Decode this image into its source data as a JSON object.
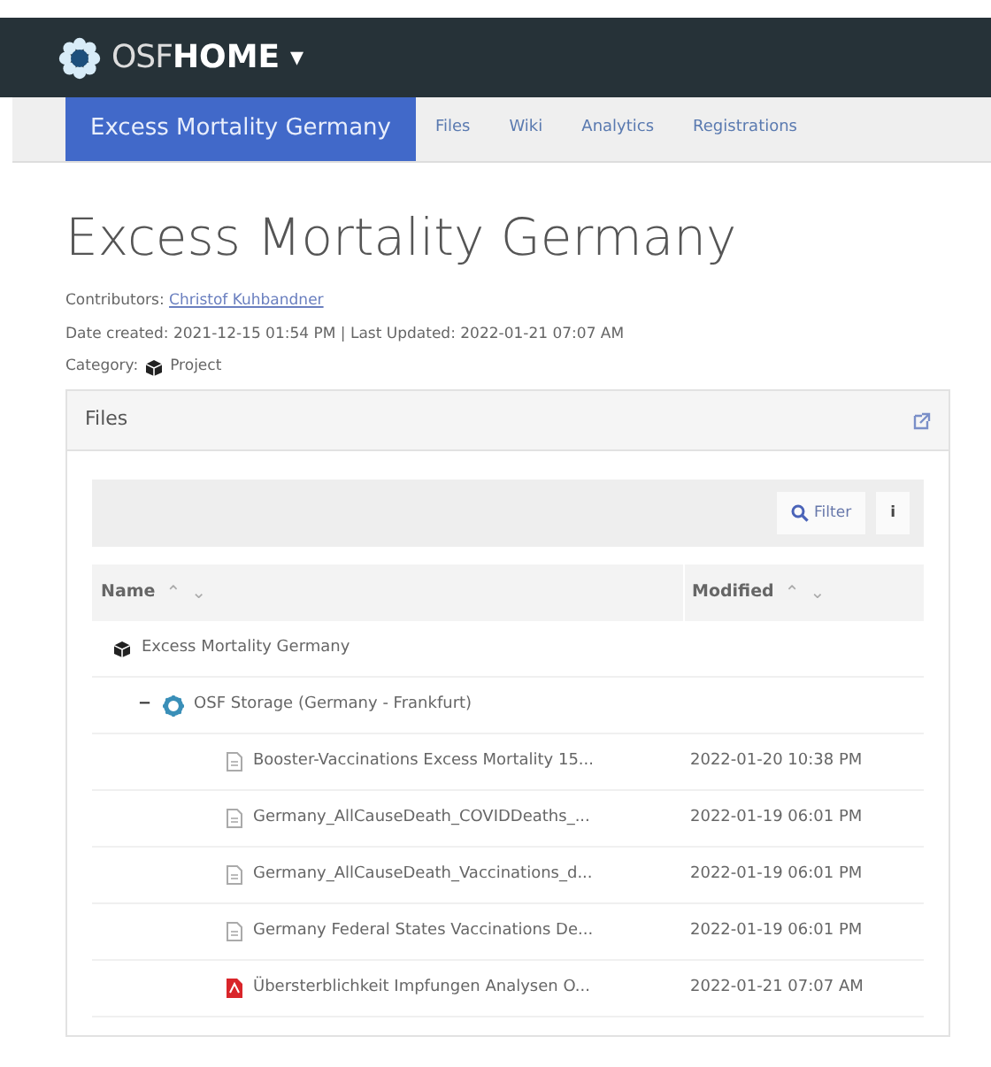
{
  "navbar": {
    "brand_light": "OSF",
    "brand_bold": "HOME",
    "caret": "▾"
  },
  "project_nav": [
    {
      "label": "Excess Mortality Germany",
      "selected": true
    },
    {
      "label": "Files",
      "selected": false
    },
    {
      "label": "Wiki",
      "selected": false
    },
    {
      "label": "Analytics",
      "selected": false
    },
    {
      "label": "Registrations",
      "selected": false
    }
  ],
  "title": "Excess Mortality Germany",
  "contributors": {
    "label": "Contributors:",
    "name": "Christof Kuhbandner"
  },
  "dates": "Date created: 2021-12-15 01:54 PM | Last Updated: 2022-01-21 07:07 AM",
  "category": {
    "label": "Category:",
    "value": "Project"
  },
  "files_panel": {
    "title": "Files",
    "toolbar": {
      "filter": "Filter",
      "info": "i"
    },
    "columns": [
      {
        "label": "Name",
        "sort_up": "⌃",
        "sort_down": "⌄"
      },
      {
        "label": "Modified",
        "sort_up": "⌃",
        "sort_down": "⌄"
      }
    ],
    "tree": [
      {
        "kind": "project",
        "name": "Excess Mortality Germany",
        "children": [
          {
            "kind": "storage",
            "toggle": "−",
            "expanded": true,
            "name": "OSF Storage (Germany - Frankfurt)",
            "children": [
              {
                "kind": "file",
                "name": "Booster-Vaccinations Excess Mortality 15...",
                "modified": "2022-01-20 10:38 PM"
              },
              {
                "kind": "file",
                "name": "Germany_AllCauseDeath_COVIDDeaths_...",
                "modified": "2022-01-19 06:01 PM"
              },
              {
                "kind": "file",
                "name": "Germany_AllCauseDeath_Vaccinations_d...",
                "modified": "2022-01-19 06:01 PM"
              },
              {
                "kind": "file",
                "name": "Germany Federal States Vaccinations De...",
                "modified": "2022-01-19 06:01 PM"
              },
              {
                "kind": "pdf",
                "name": "Übersterblichkeit Impfungen Analysen O...",
                "modified": "2022-01-21 07:07 AM"
              }
            ]
          }
        ]
      }
    ]
  }
}
